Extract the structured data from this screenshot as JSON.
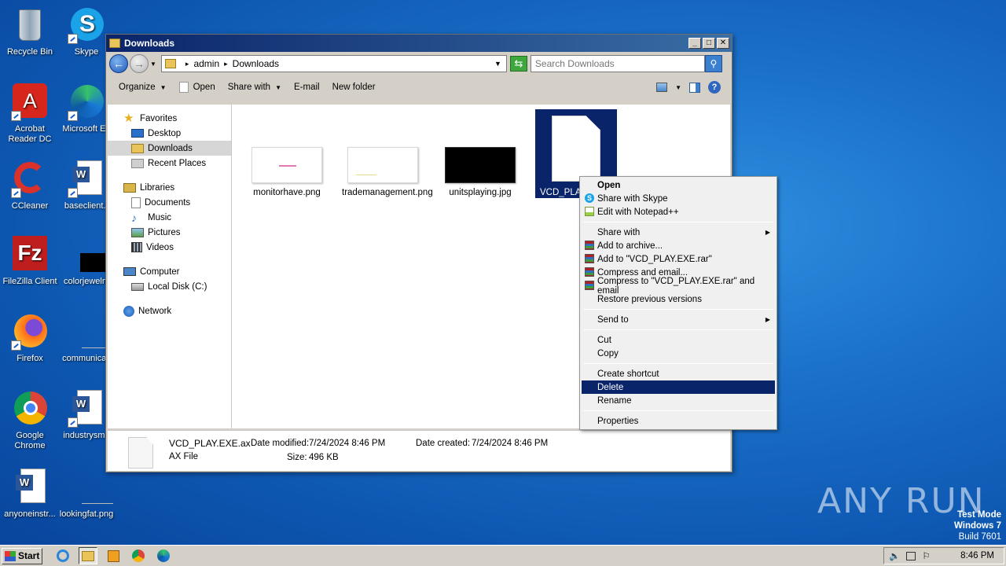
{
  "desktop": {
    "icons": [
      {
        "label": "Recycle Bin"
      },
      {
        "label": "Skype"
      },
      {
        "label": "Acrobat Reader DC"
      },
      {
        "label": "Microsoft Ed"
      },
      {
        "label": "CCleaner"
      },
      {
        "label": "baseclient.r"
      },
      {
        "label": "FileZilla Client"
      },
      {
        "label": "colorjewelry"
      },
      {
        "label": "Firefox"
      },
      {
        "label": "communicati"
      },
      {
        "label": "Google Chrome"
      },
      {
        "label": "industrysma"
      },
      {
        "label": "anyoneinstr..."
      },
      {
        "label": "lookingfat.png"
      }
    ]
  },
  "window": {
    "title": "Downloads",
    "address": {
      "crumbs": [
        "admin",
        "Downloads"
      ]
    },
    "search_placeholder": "Search Downloads",
    "toolbar": {
      "organize": "Organize",
      "open": "Open",
      "share_with": "Share with",
      "email": "E-mail",
      "new_folder": "New folder"
    },
    "nav": {
      "favorites": "Favorites",
      "desktop": "Desktop",
      "downloads": "Downloads",
      "recent": "Recent Places",
      "libraries": "Libraries",
      "documents": "Documents",
      "music": "Music",
      "pictures": "Pictures",
      "videos": "Videos",
      "computer": "Computer",
      "local_disk": "Local Disk (C:)",
      "network": "Network"
    },
    "files": [
      {
        "name": "monitorhave.png"
      },
      {
        "name": "trademanagement.png"
      },
      {
        "name": "unitsplaying.jpg"
      },
      {
        "name": "VCD_PLAY"
      }
    ],
    "details": {
      "filename": "VCD_PLAY.EXE.ax",
      "type": "AX File",
      "modified_label": "Date modified:",
      "modified": "7/24/2024 8:46 PM",
      "size_label": "Size:",
      "size": "496 KB",
      "created_label": "Date created:",
      "created": "7/24/2024 8:46 PM"
    }
  },
  "context_menu": {
    "open": "Open",
    "share_skype": "Share with Skype",
    "notepad": "Edit with Notepad++",
    "share_with": "Share with",
    "add_archive": "Add to archive...",
    "add_rar": "Add to \"VCD_PLAY.EXE.rar\"",
    "compress_email": "Compress and email...",
    "compress_rar_email": "Compress to \"VCD_PLAY.EXE.rar\" and email",
    "restore": "Restore previous versions",
    "send_to": "Send to",
    "cut": "Cut",
    "copy": "Copy",
    "create_shortcut": "Create shortcut",
    "delete": "Delete",
    "rename": "Rename",
    "properties": "Properties"
  },
  "taskbar": {
    "start": "Start",
    "clock": "8:46 PM"
  },
  "watermark": "ANY RUN",
  "system": {
    "test_mode": "Test Mode",
    "os": "Windows 7",
    "build": "Build 7601"
  }
}
